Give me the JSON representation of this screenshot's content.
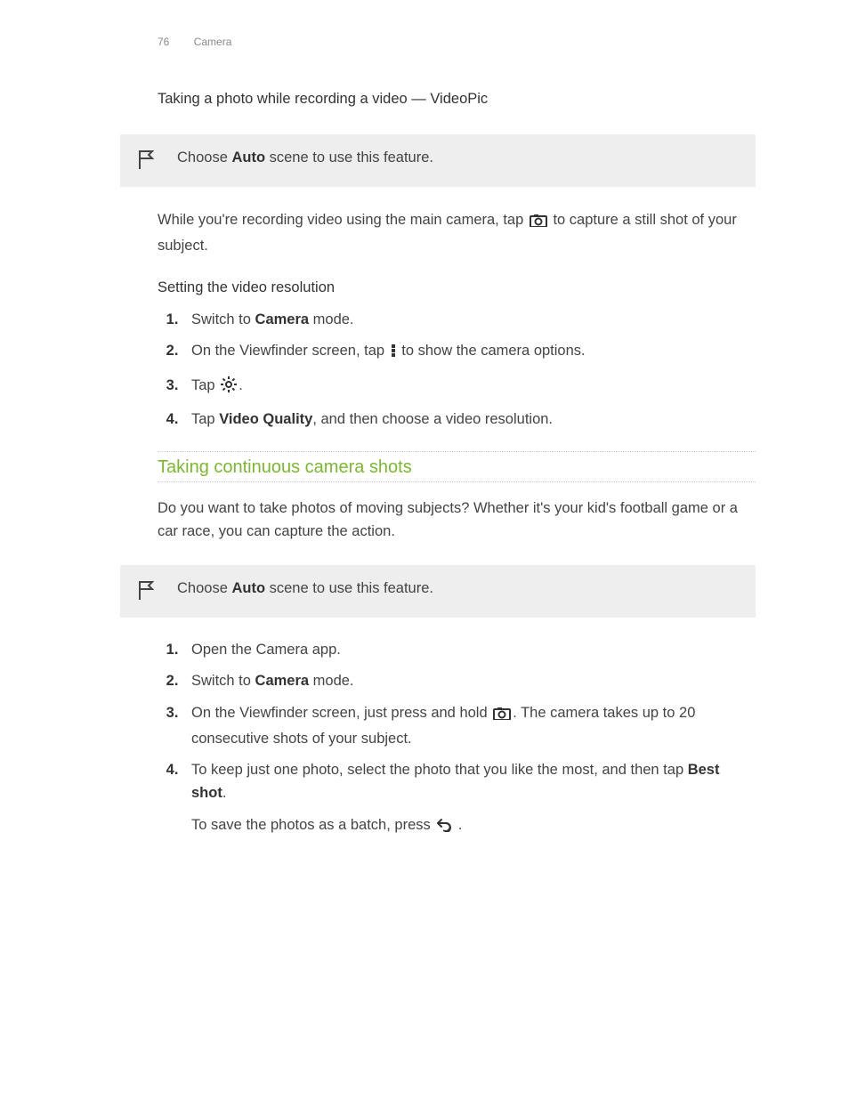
{
  "header": {
    "page_number": "76",
    "chapter": "Camera"
  },
  "section1": {
    "title": "Taking a photo while recording a video — VideoPic",
    "note_pre": "Choose ",
    "note_bold": "Auto",
    "note_post": " scene to use this feature.",
    "para_pre": "While you're recording video using the main camera, tap ",
    "para_post": " to capture a still shot of your subject.",
    "subhead": "Setting the video resolution",
    "steps": {
      "s1_pre": "Switch to ",
      "s1_bold": "Camera",
      "s1_post": " mode.",
      "s2_pre": "On the Viewfinder screen, tap ",
      "s2_post": " to show the camera options.",
      "s3_pre": "Tap ",
      "s3_post": ".",
      "s4_pre": "Tap ",
      "s4_bold": "Video Quality",
      "s4_post": ", and then choose a video resolution."
    }
  },
  "section2": {
    "heading": "Taking continuous camera shots",
    "intro": "Do you want to take photos of moving subjects? Whether it's your kid's football game or a car race, you can capture the action.",
    "note_pre": "Choose ",
    "note_bold": "Auto",
    "note_post": " scene to use this feature.",
    "steps": {
      "s1": "Open the Camera app.",
      "s2_pre": "Switch to ",
      "s2_bold": "Camera",
      "s2_post": " mode.",
      "s3_pre": "On the Viewfinder screen, just press and hold ",
      "s3_post": ". The camera takes up to 20 consecutive shots of your subject.",
      "s4_pre": "To keep just one photo, select the photo that you like the most, and then tap ",
      "s4_bold": "Best shot",
      "s4_post": ".",
      "s4_follow_pre": "To save the photos as a batch, press ",
      "s4_follow_post": " ."
    }
  }
}
